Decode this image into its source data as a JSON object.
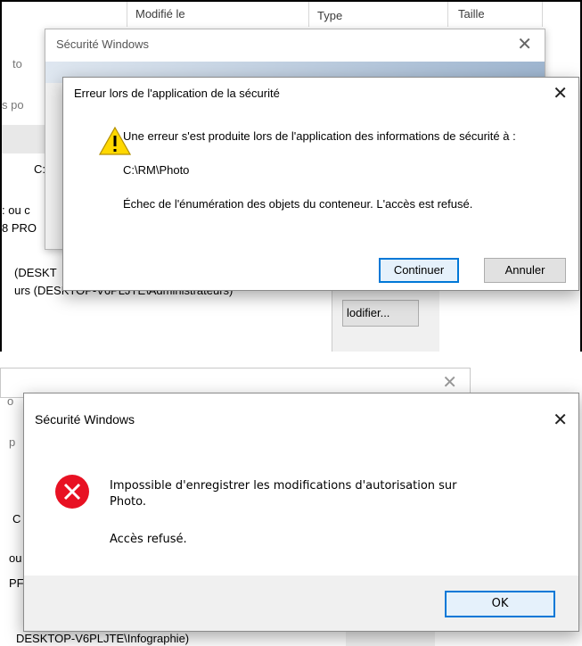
{
  "top": {
    "columns": [
      "Modifié le",
      "Type",
      "Taille"
    ],
    "bg_fragments": [
      "to",
      "s po",
      "C:\\",
      ": ou c",
      "8 PRO",
      "(DESKT",
      "urs (DESKTOP-V6PLJTE\\Administrateurs)",
      "lodifier..."
    ],
    "behind_dialog": {
      "title": "Sécurité Windows"
    },
    "error_dialog": {
      "title": "Erreur lors de l'application de la sécurité",
      "message": "Une erreur s'est produite lors de l'application des informations de sécurité à :",
      "path": "C:\\RM\\Photo",
      "detail": "Échec de l'énumération des objets du conteneur. L'accès est refusé.",
      "continue_label": "Continuer",
      "cancel_label": "Annuler",
      "icon": "warning-icon"
    }
  },
  "bottom": {
    "bg_fragments": [
      "o",
      "p",
      "C",
      "ou",
      "PF",
      "DESKTOP-V6PLJTE\\Infographie)"
    ],
    "dialog": {
      "title": "Sécurité Windows",
      "message_line1": "Impossible d'enregistrer les modifications d'autorisation sur",
      "message_line2": "Photo.",
      "detail": "Accès refusé.",
      "ok_label": "OK",
      "icon": "error-icon"
    }
  },
  "colors": {
    "accent": "#0078d7",
    "error_red": "#e81123",
    "warning_yellow": "#ffd800"
  }
}
